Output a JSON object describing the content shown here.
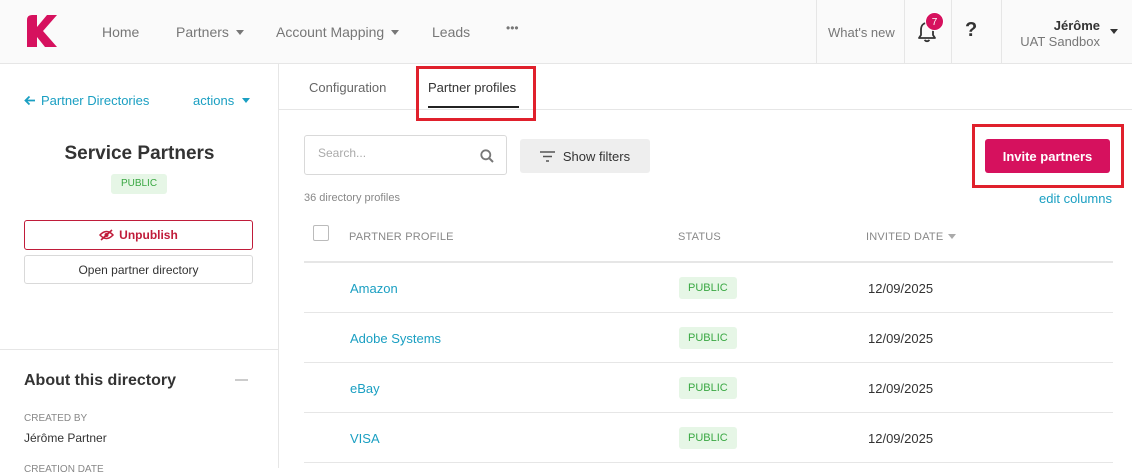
{
  "colors": {
    "brand": "#d6115e",
    "link": "#1a9fc2",
    "status_green": "#3aa843",
    "highlight": "#e0202c"
  },
  "nav": {
    "items": [
      {
        "label": "Home",
        "has_caret": false
      },
      {
        "label": "Partners",
        "has_caret": true
      },
      {
        "label": "Account Mapping",
        "has_caret": true
      },
      {
        "label": "Leads",
        "has_caret": false
      },
      {
        "label": "•••",
        "has_caret": false
      }
    ],
    "whats_new": "What's new",
    "notification_count": "7",
    "help": "?",
    "user": {
      "name": "Jérôme",
      "org": "UAT Sandbox"
    }
  },
  "sidebar": {
    "back_label": "Partner Directories",
    "actions_label": "actions",
    "title": "Service Partners",
    "status": "PUBLIC",
    "unpublish_label": "Unpublish",
    "open_label": "Open partner directory",
    "about_title": "About this directory",
    "created_by_label": "CREATED BY",
    "created_by_value": "Jérôme Partner",
    "creation_date_label": "CREATION DATE"
  },
  "tabs": [
    {
      "label": "Configuration",
      "active": false
    },
    {
      "label": "Partner profiles",
      "active": true
    }
  ],
  "toolbar": {
    "search_placeholder": "Search...",
    "filters_label": "Show filters",
    "invite_label": "Invite partners"
  },
  "table": {
    "count_text": "36 directory profiles",
    "edit_columns": "edit columns",
    "columns": [
      "PARTNER PROFILE",
      "STATUS",
      "INVITED DATE"
    ],
    "sort_column": "INVITED DATE",
    "rows": [
      {
        "name": "Amazon",
        "status": "PUBLIC",
        "date": "12/09/2025"
      },
      {
        "name": "Adobe Systems",
        "status": "PUBLIC",
        "date": "12/09/2025"
      },
      {
        "name": "eBay",
        "status": "PUBLIC",
        "date": "12/09/2025"
      },
      {
        "name": "VISA",
        "status": "PUBLIC",
        "date": "12/09/2025"
      }
    ]
  }
}
